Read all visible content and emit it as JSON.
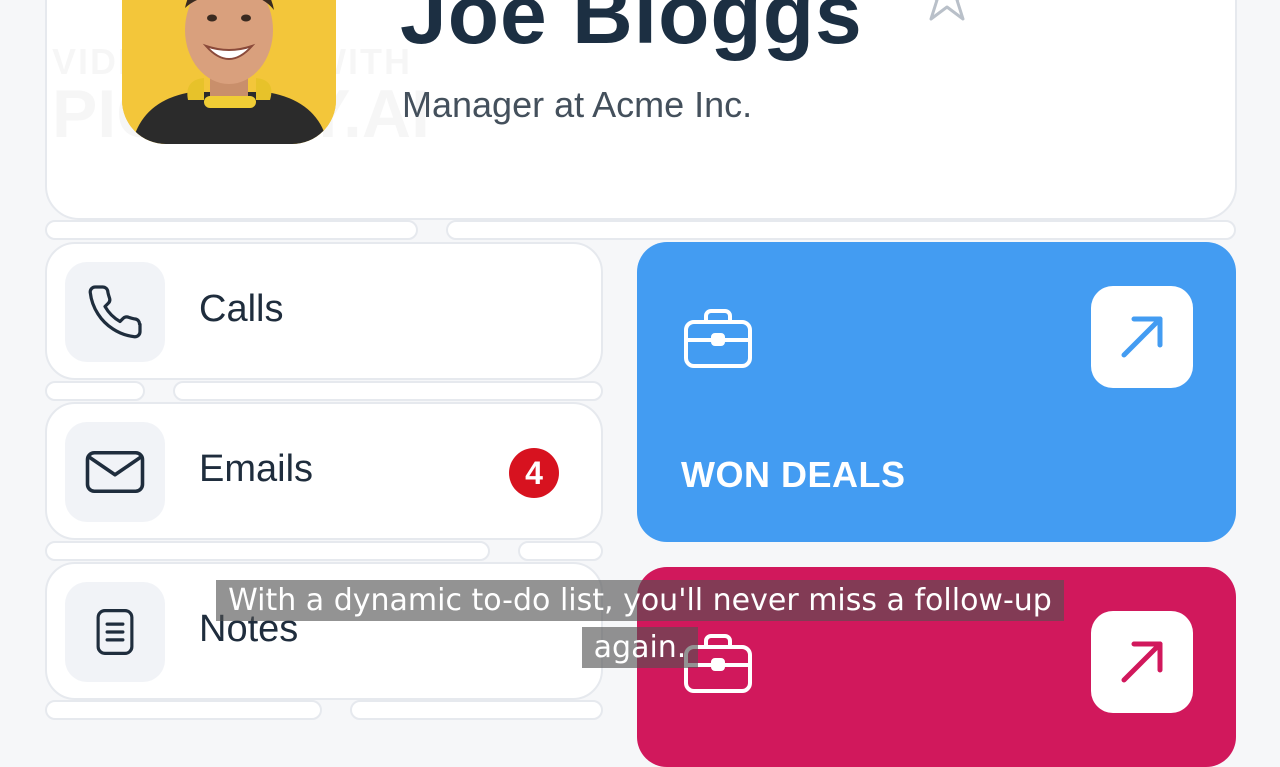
{
  "profile": {
    "name": "Joe Bloggs",
    "subtitle": "Manager at Acme Inc.",
    "watermark_line1": "VIDEO MADE WITH",
    "watermark_line2": "PICTORY.AI",
    "favorite_icon": "star-outline-icon"
  },
  "menu": {
    "items": [
      {
        "label": "Calls",
        "icon": "phone-icon"
      },
      {
        "label": "Emails",
        "icon": "mail-icon",
        "badge": "4"
      },
      {
        "label": "Notes",
        "icon": "note-icon"
      }
    ]
  },
  "tiles": [
    {
      "label": "WON DEALS",
      "icon": "briefcase-icon",
      "action_icon": "arrow-up-right-icon",
      "color": "#439cf2"
    },
    {
      "label": "",
      "icon": "briefcase-icon",
      "action_icon": "arrow-up-right-icon",
      "color": "#d1185c"
    }
  ],
  "caption": {
    "line1": "With a dynamic to-do list, you'll never miss a follow-up",
    "line2": "again."
  },
  "colors": {
    "background": "#f6f7f9",
    "badge": "#d7121f",
    "text_dark": "#1c2f42"
  }
}
